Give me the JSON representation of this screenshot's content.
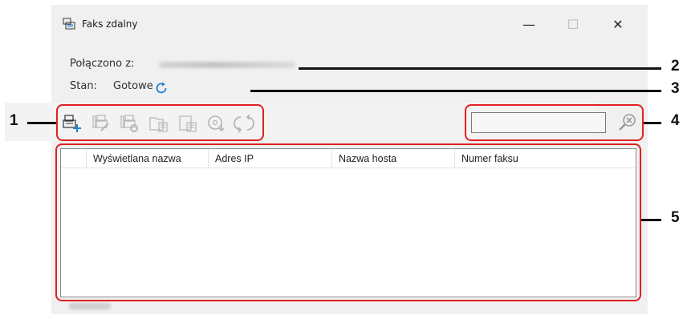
{
  "window": {
    "title": "Faks zdalny",
    "min_glyph": "—",
    "max_glyph": "☐",
    "close_glyph": "✕"
  },
  "info": {
    "connected_label": "Połączono z:",
    "status_label": "Stan:",
    "status_value": "Gotowe"
  },
  "toolbar": {
    "icons": [
      "add-fax-icon",
      "edit-fax-icon",
      "fax-settings-icon",
      "import-icon",
      "export-icon",
      "download-icon",
      "refresh-list-icon"
    ]
  },
  "search": {
    "value": "",
    "placeholder": ""
  },
  "table": {
    "columns": [
      "",
      "Wyświetlana nazwa",
      "Adres IP",
      "Nazwa hosta",
      "Numer faksu"
    ],
    "rows": []
  },
  "callouts": [
    "1",
    "2",
    "3",
    "4",
    "5"
  ],
  "colors": {
    "callout_border": "#e02020",
    "accent": "#1f7fd6"
  }
}
